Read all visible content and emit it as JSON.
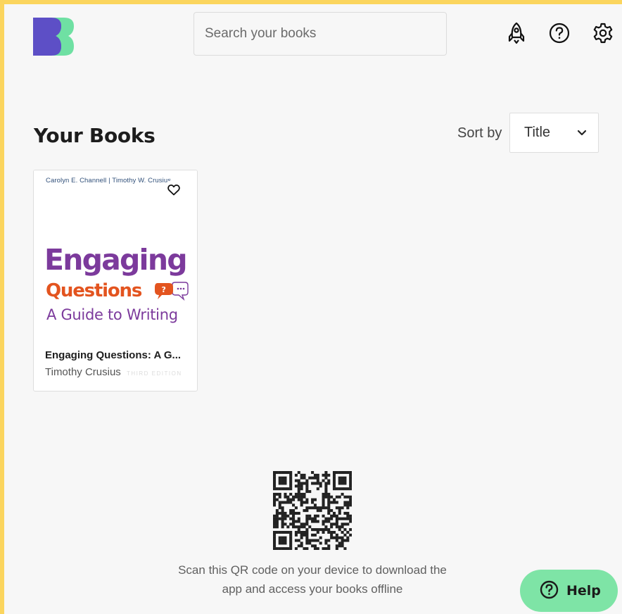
{
  "header": {
    "search_placeholder": "Search your books",
    "icons": [
      "rocket-icon",
      "help-circle-icon",
      "gear-icon"
    ]
  },
  "main": {
    "title": "Your Books",
    "sort_label": "Sort by",
    "sort_value": "Title"
  },
  "books": [
    {
      "title": "Engaging Questions: A G...",
      "author": "Timothy Crusius",
      "cover": {
        "authors_line": "Carolyn E. Channell  |  Timothy W. Crusius",
        "title_line1": "Engaging",
        "title_line2": "Questions",
        "subtitle": "A Guide to Writing",
        "edition": "THIRD EDITION",
        "colors": {
          "title": "#7c3a9c",
          "accent": "#e3541f"
        }
      }
    }
  ],
  "qr": {
    "caption_line1": "Scan this QR code on your device to download the",
    "caption_line2": "app and access your books offline"
  },
  "help": {
    "label": "Help"
  },
  "colors": {
    "frame": "#fbd55e",
    "logo_purple": "#5d4fc6",
    "logo_green": "#6fe0a3",
    "help_button": "#7ee4a6"
  }
}
